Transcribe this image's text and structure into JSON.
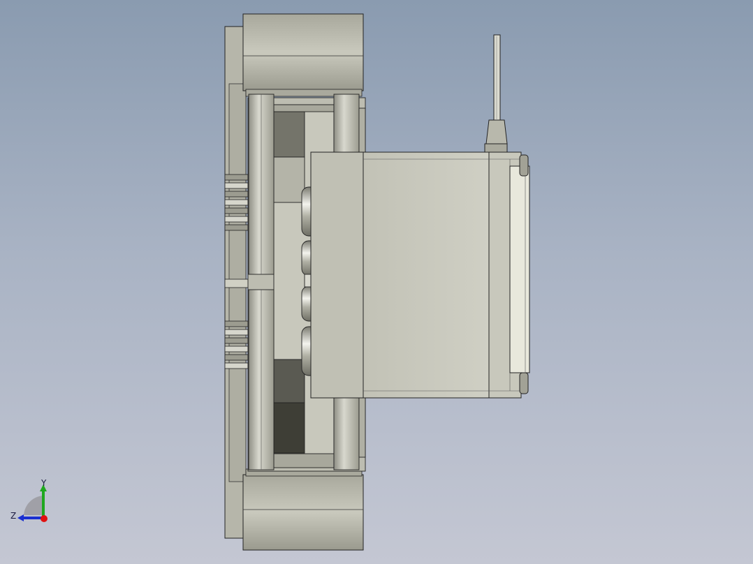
{
  "view": {
    "background_top": "#8a9bb0",
    "background_bottom": "#c4c7d3",
    "part_color": "#c4c4b8",
    "edge_color": "#222222"
  },
  "triad": {
    "y_label": "Y",
    "z_label": "Z",
    "y_color": "#1fa81f",
    "z_color": "#1a2fd0",
    "x_color": "#e01010"
  }
}
